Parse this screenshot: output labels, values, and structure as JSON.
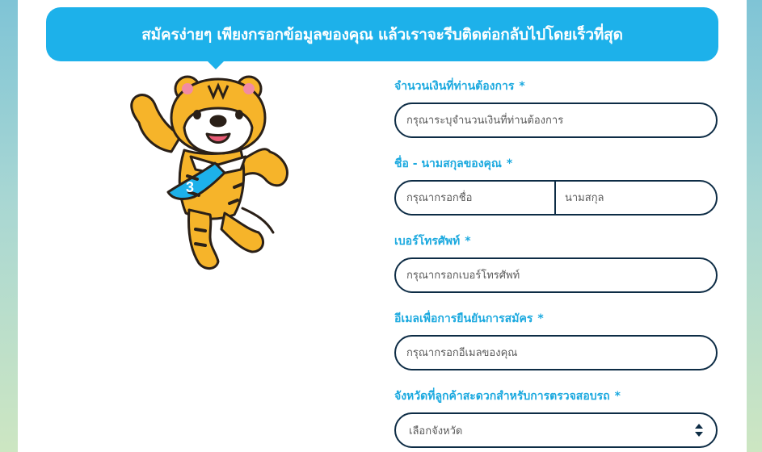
{
  "banner": {
    "text": "สมัครง่ายๆ เพียงกรอกข้อมูลของคุณ แล้วเราจะรีบติดต่อกลับไปโดยเร็วที่สุด"
  },
  "mascot": {
    "tie_text": "3"
  },
  "form": {
    "amount": {
      "label": "จำนวนเงินที่ท่านต้องการ",
      "required": "*",
      "placeholder": "กรุณาระบุจำนวนเงินที่ท่านต้องการ"
    },
    "name": {
      "label": "ชื่อ - นามสกุลของคุณ",
      "required": "*",
      "first_placeholder": "กรุณากรอกชื่อ",
      "last_placeholder": "นามสกุล"
    },
    "phone": {
      "label": "เบอร์โทรศัพท์",
      "required": "*",
      "placeholder": "กรุณากรอกเบอร์โทรศัพท์"
    },
    "email": {
      "label": "อีเมลเพื่อการยืนยันการสมัคร",
      "required": "*",
      "placeholder": "กรุณากรอกอีเมลของคุณ"
    },
    "province": {
      "label": "จังหวัดที่ลูกค้าสะดวกสำหรับการตรวจสอบรถ",
      "required": "*",
      "selected": "เลือกจังหวัด"
    }
  },
  "colors": {
    "accent": "#1db1ea",
    "border": "#0d2c45",
    "label": "#1ba9df",
    "tiger": "#f6b42a"
  }
}
